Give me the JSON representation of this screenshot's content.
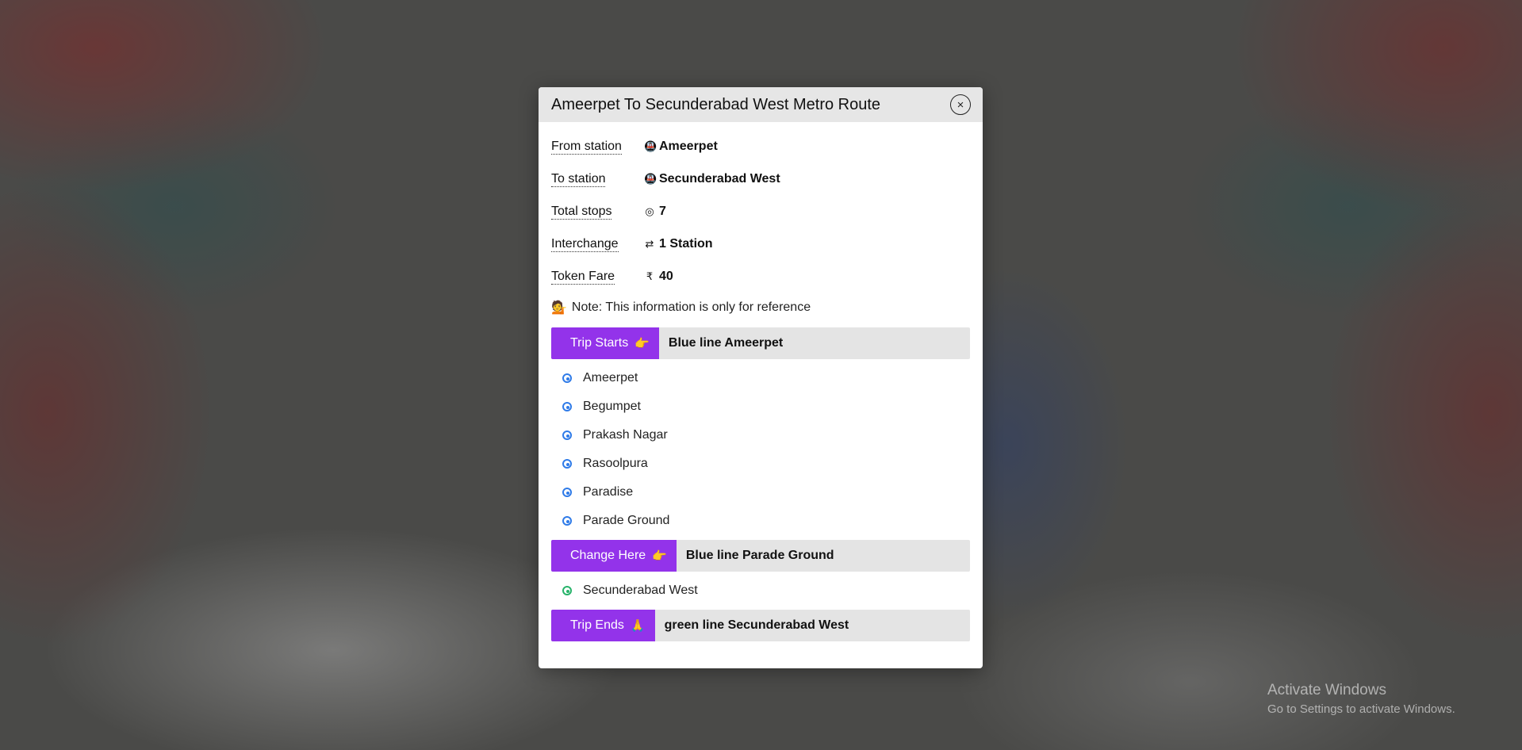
{
  "modal": {
    "title": "Ameerpet To Secunderabad West Metro Route",
    "close_icon": "×"
  },
  "info": [
    {
      "label": "From station",
      "icon": "train-icon",
      "glyph": "🚇",
      "value": "Ameerpet"
    },
    {
      "label": "To station",
      "icon": "train-icon",
      "glyph": "🚇",
      "value": "Secunderabad West"
    },
    {
      "label": "Total stops",
      "icon": "target-icon",
      "glyph": "◎",
      "value": "7"
    },
    {
      "label": "Interchange",
      "icon": "swap-arrows-icon",
      "glyph": "⇄",
      "value": "1 Station"
    },
    {
      "label": "Token Fare",
      "icon": "rupee-icon",
      "glyph": "₹",
      "value": "40"
    }
  ],
  "note": {
    "icon": "person-tipping-hand-icon",
    "glyph": "💁",
    "text": "Note: This information is only for reference"
  },
  "sections": {
    "start": {
      "button": "Trip Starts",
      "icon": "hand-pointing-right-icon",
      "glyph": "👉",
      "label": "Blue line Ameerpet"
    },
    "start_stations": [
      "Ameerpet",
      "Begumpet",
      "Prakash Nagar",
      "Rasoolpura",
      "Paradise",
      "Parade Ground"
    ],
    "change": {
      "button": "Change Here",
      "icon": "hand-pointing-right-icon",
      "glyph": "👉",
      "label": "Blue line Parade Ground"
    },
    "change_stations": [
      "Secunderabad West"
    ],
    "end": {
      "button": "Trip Ends",
      "icon": "folded-hands-icon",
      "glyph": "🙏",
      "label": "green line Secunderabad West"
    }
  },
  "colors": {
    "accent": "#9333ea",
    "blue_line": "#2f7be8",
    "green_line": "#27b36a"
  },
  "watermark": {
    "title": "Activate Windows",
    "subtitle": "Go to Settings to activate Windows."
  }
}
